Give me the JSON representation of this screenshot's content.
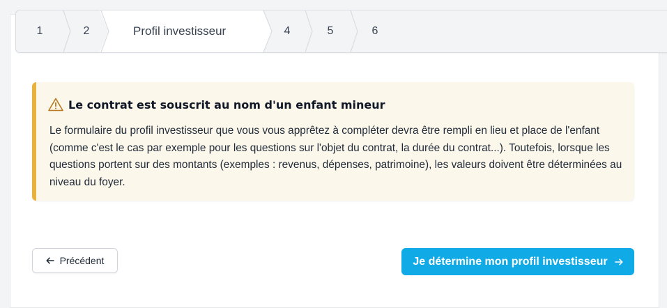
{
  "stepper": {
    "steps": [
      {
        "label": "1",
        "active": false
      },
      {
        "label": "2",
        "active": false
      },
      {
        "label": "Profil investisseur",
        "active": true
      },
      {
        "label": "4",
        "active": false
      },
      {
        "label": "5",
        "active": false
      },
      {
        "label": "6",
        "active": false
      }
    ]
  },
  "alert": {
    "title": "Le contrat est souscrit au nom d'un enfant mineur",
    "body": "Le formulaire du profil investisseur que vous vous apprêtez à compléter devra être rempli en lieu et place de l'enfant (comme c'est le cas par exemple pour les questions sur l'objet du contrat, la durée du contrat...). Toutefois, lorsque les questions portent sur des montants (exemples : revenus, dépenses, patrimoine), les valeurs doivent être déterminées au niveau du foyer.",
    "icon": "warning-icon",
    "accent_color": "#e9b13d",
    "background_color": "#fbf7ea"
  },
  "actions": {
    "previous_label": "Précédent",
    "next_label": "Je détermine mon profil investisseur",
    "next_color": "#10aae6"
  },
  "colors": {
    "page_background": "#f3f4f6",
    "card_background": "#ffffff"
  }
}
